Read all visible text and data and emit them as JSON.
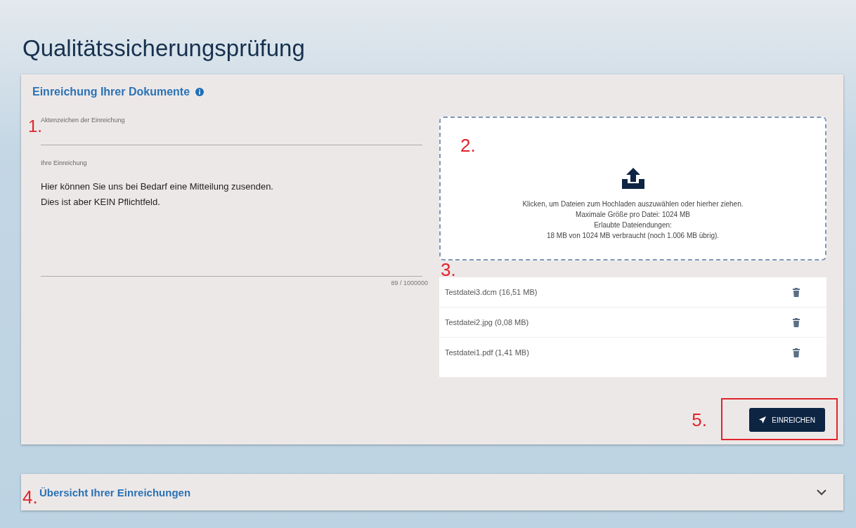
{
  "page_title": "Qualitätssicherungsprüfung",
  "submission_card": {
    "title": "Einreichung Ihrer Dokumente",
    "reference_field": {
      "marker": "1.",
      "label": "Aktenzeichen der Einreichung"
    },
    "message_field": {
      "label": "Ihre Einreichung",
      "value": "Hier können Sie uns bei Bedarf eine Mitteilung zusenden.\nDies ist aber KEIN Pflichtfeld.",
      "counter": "89 / 1000000"
    },
    "dropzone": {
      "marker": "2.",
      "lines": [
        "Klicken, um Dateien zum Hochladen auszuwählen oder hierher ziehen.",
        "Maximale Größe pro Datei: 1024 MB",
        "Erlaubte Dateiendungen:",
        "18 MB von 1024 MB verbraucht (noch 1.006 MB übrig)."
      ]
    },
    "files": {
      "marker": "3.",
      "items": [
        {
          "name": "Testdatei3.dcm (16,51 MB)"
        },
        {
          "name": "Testdatei2.jpg (0,08 MB)"
        },
        {
          "name": "Testdatei1.pdf (1,41 MB)"
        }
      ]
    },
    "submit": {
      "marker": "5.",
      "label": "EINREICHEN",
      "highlighted": true
    }
  },
  "overview": {
    "marker": "4.",
    "title": "Übersicht Ihrer Einreichungen",
    "expanded": false
  }
}
